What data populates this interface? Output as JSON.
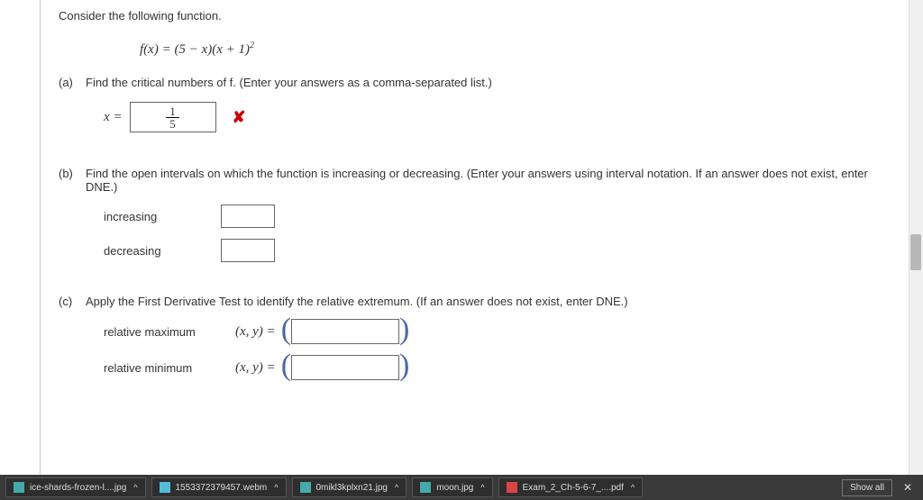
{
  "intro": "Consider the following function.",
  "formula_html": "f(x) = (5 − x)(x + 1)<sup>2</sup>",
  "parts": {
    "a": {
      "label": "(a)",
      "prompt": "Find the critical numbers of f. (Enter your answers as a comma-separated list.)",
      "var": "x =",
      "entered_num": "1",
      "entered_den": "5",
      "wrong": "✘"
    },
    "b": {
      "label": "(b)",
      "prompt": "Find the open intervals on which the function is increasing or decreasing. (Enter your answers using interval notation. If an answer does not exist, enter DNE.)",
      "inc_label": "increasing",
      "dec_label": "decreasing"
    },
    "c": {
      "label": "(c)",
      "prompt": "Apply the First Derivative Test to identify the relative extremum. (If an answer does not exist, enter DNE.)",
      "max_label": "relative maximum",
      "min_label": "relative minimum",
      "xy": "(x, y)  ="
    }
  },
  "downloads": {
    "items": [
      {
        "name": "ice-shards-frozen-l....jpg",
        "icon": "img"
      },
      {
        "name": "1553372379457.webm",
        "icon": "vid"
      },
      {
        "name": "0mikl3kplxn21.jpg",
        "icon": "img"
      },
      {
        "name": "moon.jpg",
        "icon": "img"
      },
      {
        "name": "Exam_2_Ch-5-6-7_....pdf",
        "icon": "pdf"
      }
    ],
    "show_all": "Show all",
    "close": "✕",
    "caret": "^"
  }
}
